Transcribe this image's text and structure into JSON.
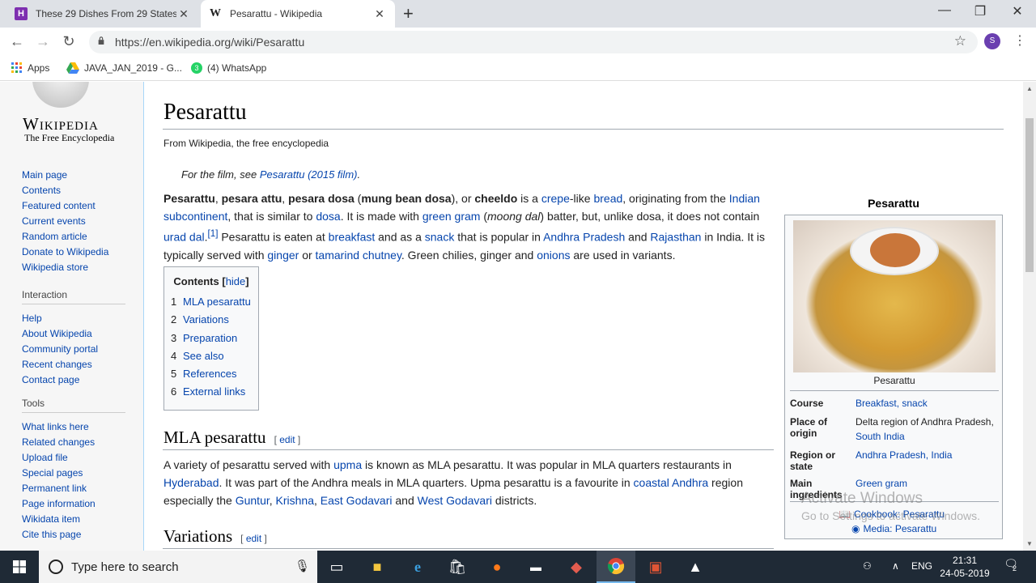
{
  "browser": {
    "tabs": [
      {
        "title": "These 29 Dishes From 29 States",
        "favicon": "H"
      },
      {
        "title": "Pesarattu - Wikipedia",
        "favicon": "W"
      }
    ],
    "new_tab": "+",
    "window_controls": {
      "minimize": "—",
      "restore": "❐",
      "close": "✕"
    },
    "nav": {
      "back": "←",
      "forward": "→",
      "reload": "↻"
    },
    "url": "https://en.wikipedia.org/wiki/Pesarattu",
    "profile_initial": "S",
    "menu_glyph": "⋮",
    "star_glyph": "☆",
    "bookmarks": [
      {
        "label": "Apps",
        "icon": "apps-grid-icon"
      },
      {
        "label": "JAVA_JAN_2019 - G...",
        "icon": "google-drive-icon"
      },
      {
        "label": "(4) WhatsApp",
        "icon": "whatsapp-icon"
      }
    ]
  },
  "wiki": {
    "logo": {
      "wordmark": "Wikipedia",
      "tagline": "The Free Encyclopedia"
    },
    "nav_main": [
      "Main page",
      "Contents",
      "Featured content",
      "Current events",
      "Random article",
      "Donate to Wikipedia",
      "Wikipedia store"
    ],
    "nav_interaction": {
      "heading": "Interaction",
      "items": [
        "Help",
        "About Wikipedia",
        "Community portal",
        "Recent changes",
        "Contact page"
      ]
    },
    "nav_tools": {
      "heading": "Tools",
      "items": [
        "What links here",
        "Related changes",
        "Upload file",
        "Special pages",
        "Permanent link",
        "Page information",
        "Wikidata item",
        "Cite this page"
      ]
    },
    "title": "Pesarattu",
    "sitesub": "From Wikipedia, the free encyclopedia",
    "hatnote": {
      "prefix": "For the film, see ",
      "link": "Pesarattu (2015 film)",
      "suffix": "."
    },
    "toc": {
      "title": "Contents",
      "hide": "hide",
      "items": [
        {
          "num": "1",
          "label": "MLA pesarattu"
        },
        {
          "num": "2",
          "label": "Variations"
        },
        {
          "num": "3",
          "label": "Preparation"
        },
        {
          "num": "4",
          "label": "See also"
        },
        {
          "num": "5",
          "label": "References"
        },
        {
          "num": "6",
          "label": "External links"
        }
      ]
    },
    "sections": {
      "mla": {
        "heading": "MLA pesarattu",
        "edit": "edit"
      },
      "variations": {
        "heading": "Variations",
        "edit": "edit"
      }
    },
    "infobox": {
      "title": "Pesarattu",
      "caption": "Pesarattu",
      "rows": [
        {
          "label": "Course",
          "value": "Breakfast, snack"
        },
        {
          "label": "Place of origin",
          "value": "Delta region of Andhra Pradesh, South India"
        },
        {
          "label": "Region or state",
          "value": "Andhra Pradesh, India"
        },
        {
          "label": "Main ingredients",
          "value": "Green gram"
        }
      ],
      "links": [
        "Cookbook: Pesarattu",
        "Media: Pesarattu"
      ]
    },
    "watermark": {
      "line1": "Activate Windows",
      "line2": "Go to Settings to activate Windows."
    }
  },
  "taskbar": {
    "search_placeholder": "Type here to search",
    "language": "ENG",
    "time": "21:31",
    "date": "24-05-2019",
    "notifications": "2"
  },
  "colors": {
    "link": "#0645ad",
    "taskbar": "#1f2a36",
    "tab_strip": "#dee1e6"
  }
}
